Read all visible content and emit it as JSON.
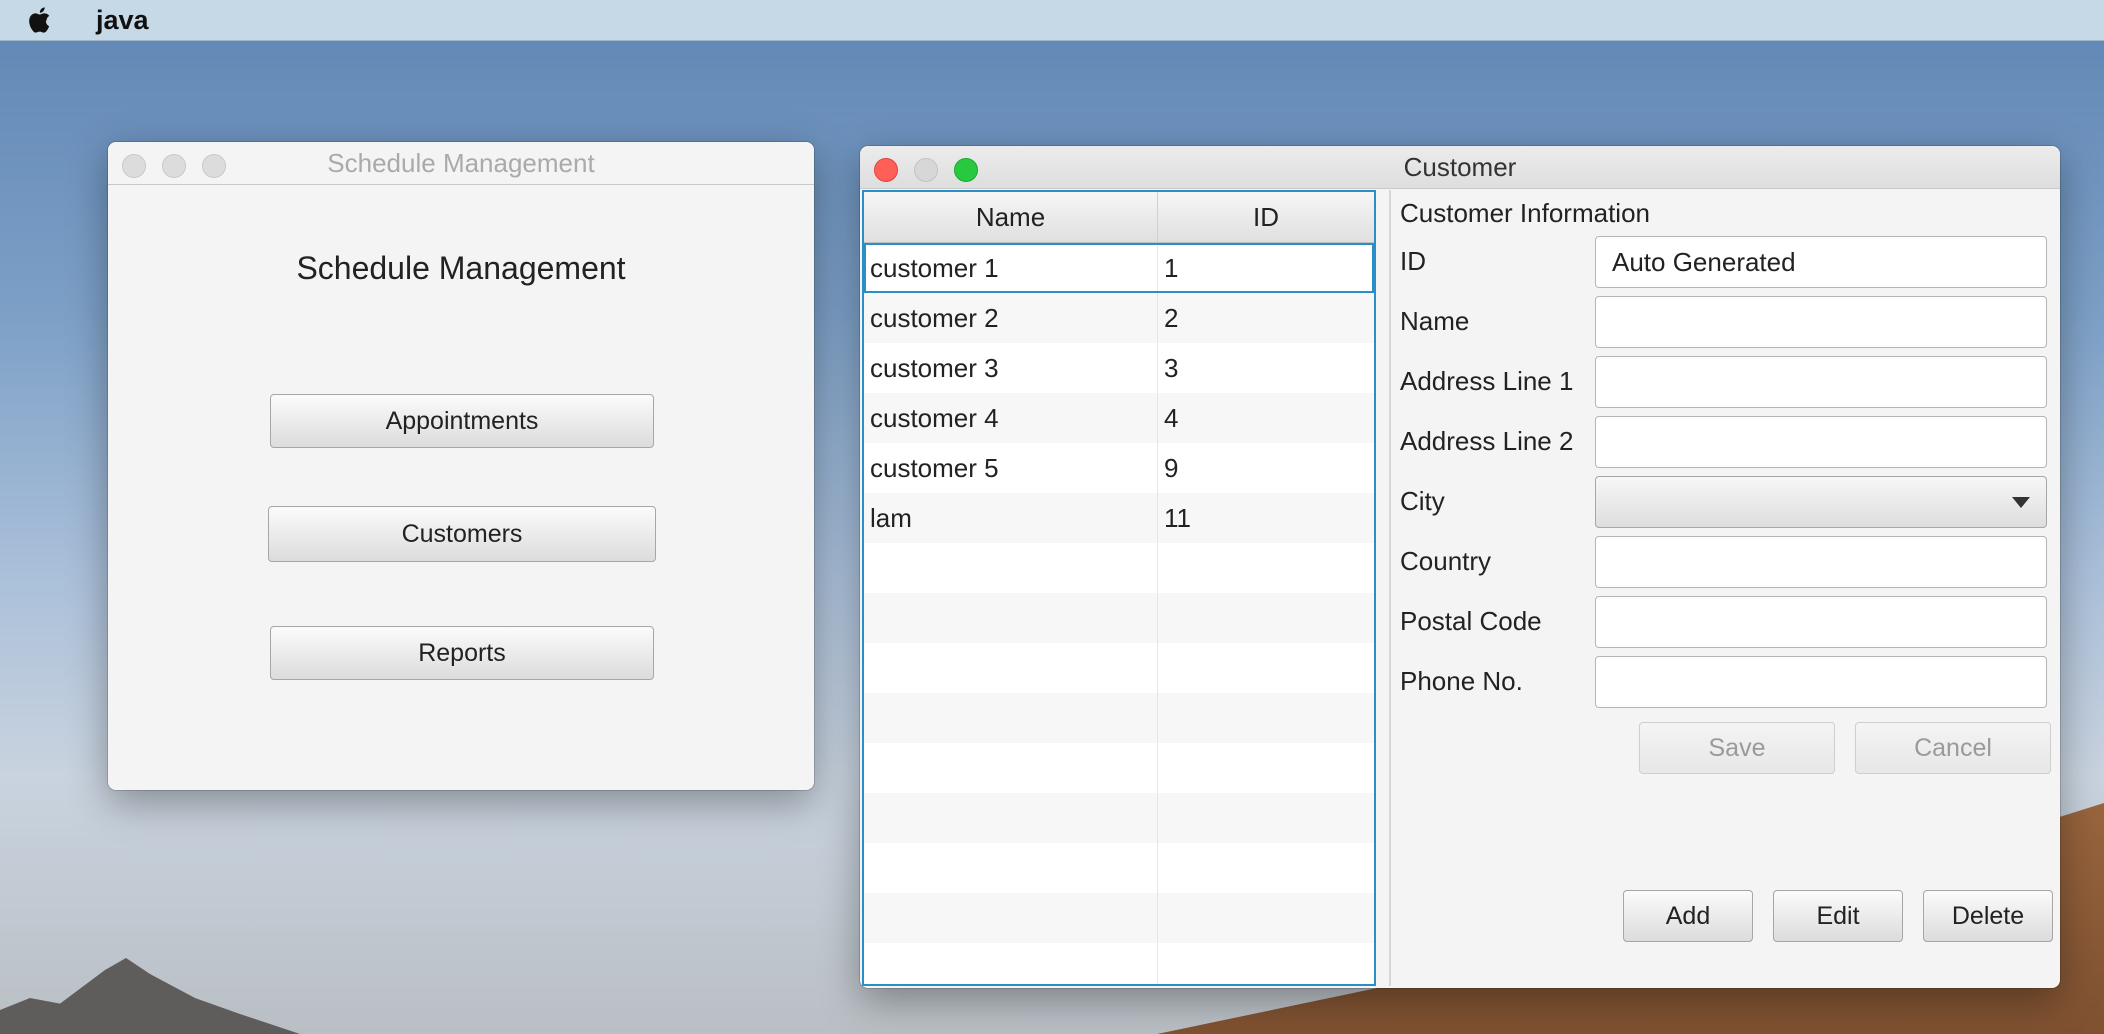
{
  "menubar": {
    "app_name": "java"
  },
  "schedule_window": {
    "title": "Schedule Management",
    "heading": "Schedule Management",
    "buttons": {
      "appointments": "Appointments",
      "customers": "Customers",
      "reports": "Reports"
    }
  },
  "customer_window": {
    "title": "Customer",
    "table": {
      "headers": [
        "Name",
        "ID"
      ],
      "rows": [
        {
          "name": "customer 1",
          "id": "1"
        },
        {
          "name": "customer 2",
          "id": "2"
        },
        {
          "name": "customer 3",
          "id": "3"
        },
        {
          "name": "customer 4",
          "id": "4"
        },
        {
          "name": "customer 5",
          "id": "9"
        },
        {
          "name": "lam",
          "id": "11"
        }
      ],
      "selected_row": 0
    },
    "form": {
      "title": "Customer Information",
      "labels": {
        "id": "ID",
        "name": "Name",
        "address1": "Address Line 1",
        "address2": "Address Line 2",
        "city": "City",
        "country": "Country",
        "postal": "Postal Code",
        "phone": "Phone No."
      },
      "values": {
        "id": "Auto Generated"
      },
      "buttons": {
        "save": "Save",
        "cancel": "Cancel",
        "add": "Add",
        "edit": "Edit",
        "delete": "Delete"
      }
    }
  }
}
